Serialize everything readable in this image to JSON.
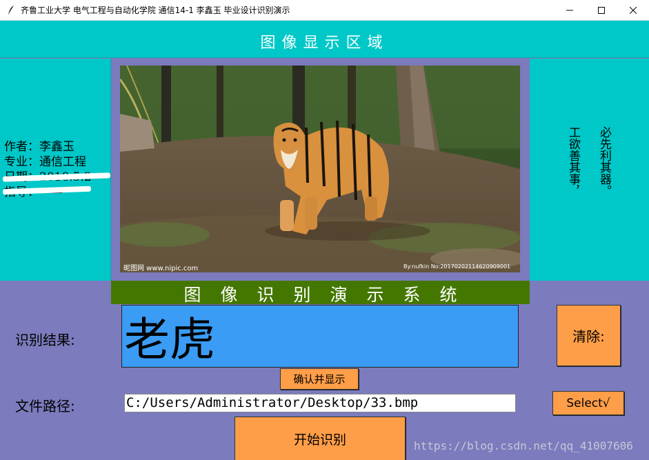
{
  "window": {
    "title": "齐鲁工业大学 电气工程与自动化学院 通信14-1 李鑫玉  毕业设计识别演示"
  },
  "header": {
    "title": "图像显示区域"
  },
  "author_info": {
    "line1": "作者：李鑫玉",
    "line2": "专业：通信工程",
    "line3": "日期：2018.5.2",
    "line4": "指导：——"
  },
  "motto": {
    "col1": "工欲善其事，",
    "col2": "必先利其器。"
  },
  "image": {
    "watermark_left": "昵图网 www.nipic.com",
    "watermark_right": "By:nufkin No:20170202114620909001"
  },
  "banner": {
    "title": "图像识别演示系统"
  },
  "result": {
    "label": "识别结果:",
    "value": "老虎",
    "clear_label": "清除:"
  },
  "confirm_label": "确认并显示",
  "file": {
    "label": "文件路径:",
    "path": "C:/Users/Administrator/Desktop/33.bmp",
    "select_label": "Select√"
  },
  "start_label": "开始识别",
  "url_watermark": "https://blog.csdn.net/qq_41007606",
  "colors": {
    "cyan": "#00c8c8",
    "purple": "#7b7bbd",
    "green": "#447700",
    "orange": "#ff9e48",
    "blue": "#3a9cf5"
  }
}
